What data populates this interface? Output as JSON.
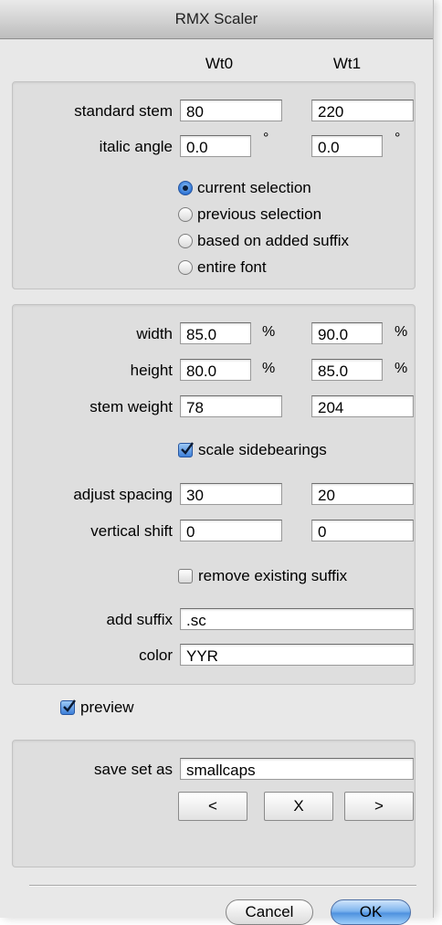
{
  "window": {
    "title": "RMX Scaler"
  },
  "columns": {
    "wt0": "Wt0",
    "wt1": "Wt1"
  },
  "stems": {
    "standard_stem": {
      "label": "standard stem",
      "wt0": "80",
      "wt1": "220"
    },
    "italic_angle": {
      "label": "italic angle",
      "wt0": "0.0",
      "wt1": "0.0",
      "unit": "°"
    }
  },
  "scope": {
    "options": [
      "current selection",
      "previous selection",
      "based on added suffix",
      "entire font"
    ],
    "selected": "current selection"
  },
  "transform": {
    "width": {
      "label": "width",
      "wt0": "85.0",
      "wt1": "90.0",
      "unit": "%"
    },
    "height": {
      "label": "height",
      "wt0": "80.0",
      "wt1": "85.0",
      "unit": "%"
    },
    "stem_weight": {
      "label": "stem weight",
      "wt0": "78",
      "wt1": "204"
    },
    "scale_sidebearings": {
      "label": "scale sidebearings",
      "checked": true
    },
    "adjust_spacing": {
      "label": "adjust spacing",
      "wt0": "30",
      "wt1": "20"
    },
    "vertical_shift": {
      "label": "vertical shift",
      "wt0": "0",
      "wt1": "0"
    },
    "remove_existing_suffix": {
      "label": "remove existing suffix",
      "checked": false
    },
    "add_suffix": {
      "label": "add suffix",
      "value": ".sc"
    },
    "color": {
      "label": "color",
      "value": "YYR"
    }
  },
  "preview": {
    "label": "preview",
    "checked": true
  },
  "sets": {
    "label": "save set as",
    "value": "smallcaps",
    "prev_label": "<",
    "delete_label": "X",
    "next_label": ">"
  },
  "actions": {
    "cancel_label": "Cancel",
    "ok_label": "OK"
  }
}
